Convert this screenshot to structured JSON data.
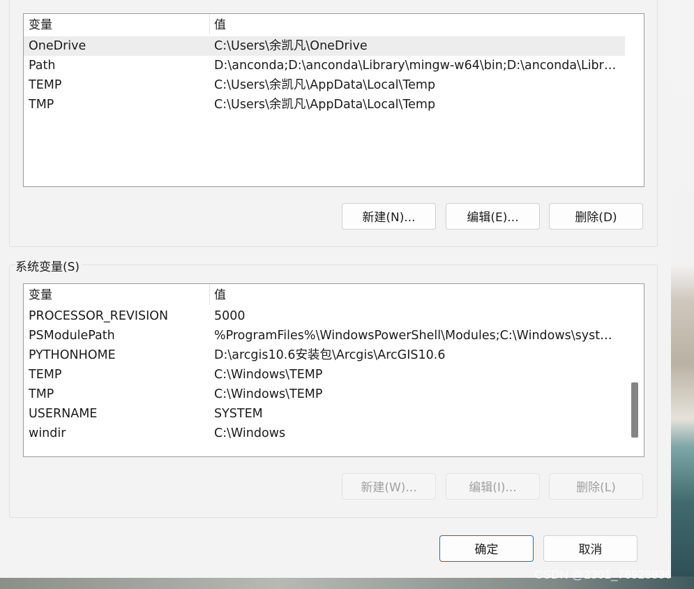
{
  "user_vars": {
    "header": {
      "var": "变量",
      "val": "值"
    },
    "rows": [
      {
        "name": "OneDrive",
        "value": "C:\\Users\\余凯凡\\OneDrive"
      },
      {
        "name": "Path",
        "value": "D:\\anconda;D:\\anconda\\Library\\mingw-w64\\bin;D:\\anconda\\Libra..."
      },
      {
        "name": "TEMP",
        "value": "C:\\Users\\余凯凡\\AppData\\Local\\Temp"
      },
      {
        "name": "TMP",
        "value": "C:\\Users\\余凯凡\\AppData\\Local\\Temp"
      }
    ],
    "buttons": {
      "new": "新建(N)...",
      "edit": "编辑(E)...",
      "delete": "删除(D)"
    }
  },
  "system_vars": {
    "legend": "系统变量(S)",
    "header": {
      "var": "变量",
      "val": "值"
    },
    "rows": [
      {
        "name": "PROCESSOR_REVISION",
        "value": "5000"
      },
      {
        "name": "PSModulePath",
        "value": "%ProgramFiles%\\WindowsPowerShell\\Modules;C:\\Windows\\syste..."
      },
      {
        "name": "PYTHONHOME",
        "value": "D:\\arcgis10.6安装包\\Arcgis\\ArcGIS10.6"
      },
      {
        "name": "TEMP",
        "value": "C:\\Windows\\TEMP"
      },
      {
        "name": "TMP",
        "value": "C:\\Windows\\TEMP"
      },
      {
        "name": "USERNAME",
        "value": "SYSTEM"
      },
      {
        "name": "windir",
        "value": "C:\\Windows"
      }
    ],
    "buttons": {
      "new": "新建(W)...",
      "edit": "编辑(I)...",
      "delete": "删除(L)"
    }
  },
  "footer": {
    "ok": "确定",
    "cancel": "取消"
  },
  "watermark": "CSDN @2301_76928836"
}
